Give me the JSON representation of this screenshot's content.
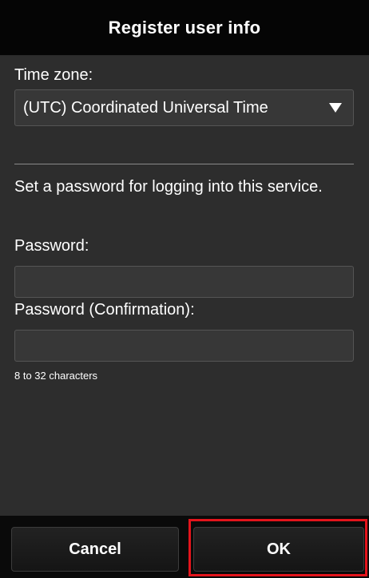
{
  "header": {
    "title": "Register user info"
  },
  "form": {
    "timezone_label": "Time zone:",
    "timezone_value": "(UTC) Coordinated Universal Time",
    "description": "Set a password for logging into this service.",
    "password_label": "Password:",
    "password_value": "",
    "password_confirm_label": "Password (Confirmation):",
    "password_confirm_value": "",
    "hint": "8 to 32 characters"
  },
  "footer": {
    "cancel_label": "Cancel",
    "ok_label": "OK"
  },
  "icons": {
    "timezone_dropdown": "triangle-down-icon"
  },
  "colors": {
    "header_bg": "#050505",
    "panel_bg": "#2d2d2d",
    "field_bg": "#373737",
    "footer_bg": "#0a0a0a",
    "highlight": "#e3141c"
  }
}
